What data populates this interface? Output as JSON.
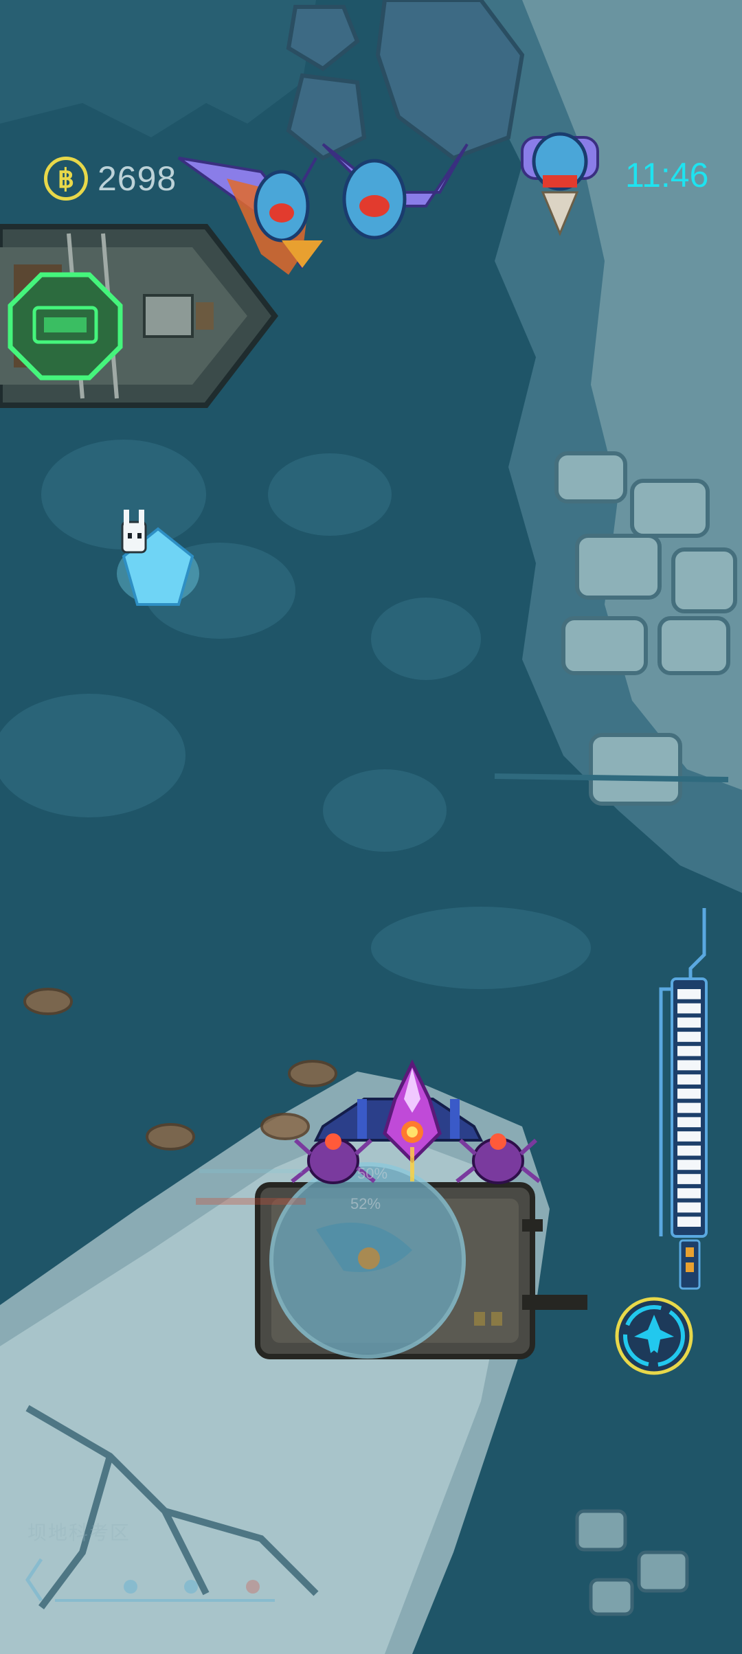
{
  "hud": {
    "coins": "2698",
    "coin_icon": "coin-icon",
    "timer": "11:46"
  },
  "ally_indicators": {
    "left_pct": "50%",
    "right_pct": "52%"
  },
  "footer": {
    "area_label": "坝地科考区"
  },
  "power_gauge": {
    "segments_total": 17,
    "segments_filled": 17,
    "reserve_cells": 2
  },
  "colors": {
    "timer": "#1ee3f0",
    "coin": "#e8d84a",
    "gauge": "#5aa8e0"
  }
}
